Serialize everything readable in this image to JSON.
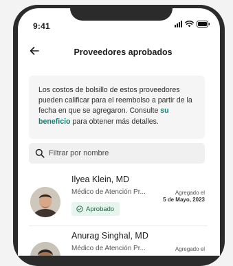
{
  "status_bar": {
    "time": "9:41"
  },
  "header": {
    "title": "Proveedores aprobados"
  },
  "info": {
    "text_before": "Los costos de bolsillo de estos proveedores pueden calificar para el reembolso a partir de la fecha en que se agregaron. Consulte ",
    "link": "su beneficio",
    "text_after": " para obtener más detalles."
  },
  "search": {
    "placeholder": "Filtrar por nombre"
  },
  "providers": [
    {
      "name": "Ilyea Klein, MD",
      "specialty": "Médico de Atención Pr...",
      "added_label": "Agregado el",
      "added_date": "5 de Mayo, 2023",
      "status": "Aprobado"
    },
    {
      "name": "Anurag Singhal, MD",
      "specialty": "Médico de Atención Pr...",
      "added_label": "Agregado el",
      "added_date": ""
    }
  ]
}
